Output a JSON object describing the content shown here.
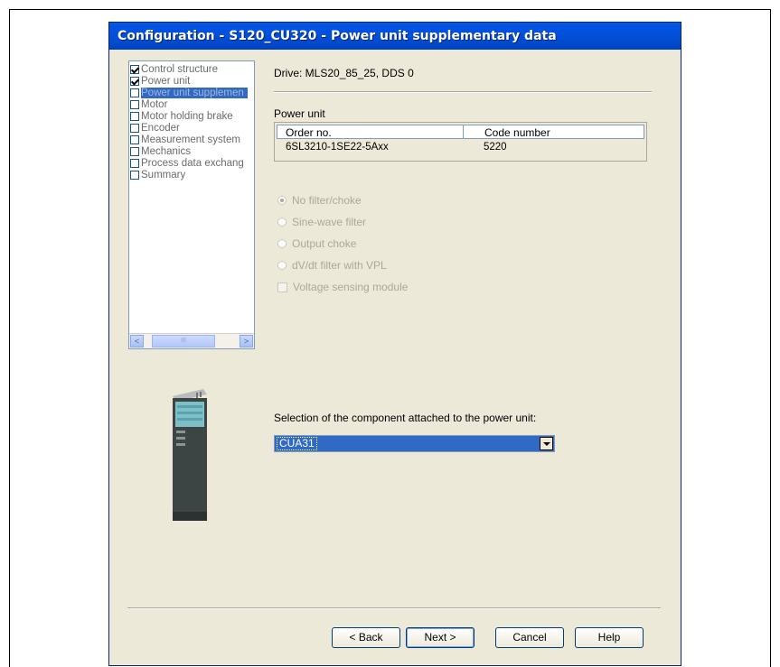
{
  "window": {
    "title": "Configuration - S120_CU320 - Power unit supplementary data"
  },
  "tree": {
    "items": [
      {
        "label": "Control structure",
        "checked": true,
        "selected": false
      },
      {
        "label": "Power unit",
        "checked": true,
        "selected": false
      },
      {
        "label": "Power unit supplemen",
        "checked": false,
        "selected": true
      },
      {
        "label": "Motor",
        "checked": false,
        "selected": false
      },
      {
        "label": "Motor holding brake",
        "checked": false,
        "selected": false
      },
      {
        "label": "Encoder",
        "checked": false,
        "selected": false
      },
      {
        "label": "Measurement system",
        "checked": false,
        "selected": false
      },
      {
        "label": "Mechanics",
        "checked": false,
        "selected": false
      },
      {
        "label": "Process data exchang",
        "checked": false,
        "selected": false
      },
      {
        "label": "Summary",
        "checked": false,
        "selected": false
      }
    ],
    "scroll_left_glyph": "<",
    "scroll_right_glyph": ">",
    "scroll_thumb_glyph": "III"
  },
  "drive_label": "Drive: MLS20_85_25, DDS 0",
  "power_unit": {
    "label": "Power unit",
    "columns": [
      "Order no.",
      "Code number"
    ],
    "row": [
      "6SL3210-1SE22-5Axx",
      "5220"
    ]
  },
  "options": {
    "no_filter": "No filter/choke",
    "sine_wave": "Sine-wave filter",
    "output_choke": "Output choke",
    "dvdt": "dV/dt filter with VPL",
    "voltage_sensing": "Voltage sensing module"
  },
  "selection": {
    "label": "Selection of the component attached to the power unit:",
    "value": "CUA31"
  },
  "buttons": {
    "back": "< Back",
    "next": "Next >",
    "cancel": "Cancel",
    "help": "Help"
  },
  "colors": {
    "titlebar": "#0450d8",
    "selection": "#316ac5",
    "dialog_bg": "#ece9d8"
  }
}
